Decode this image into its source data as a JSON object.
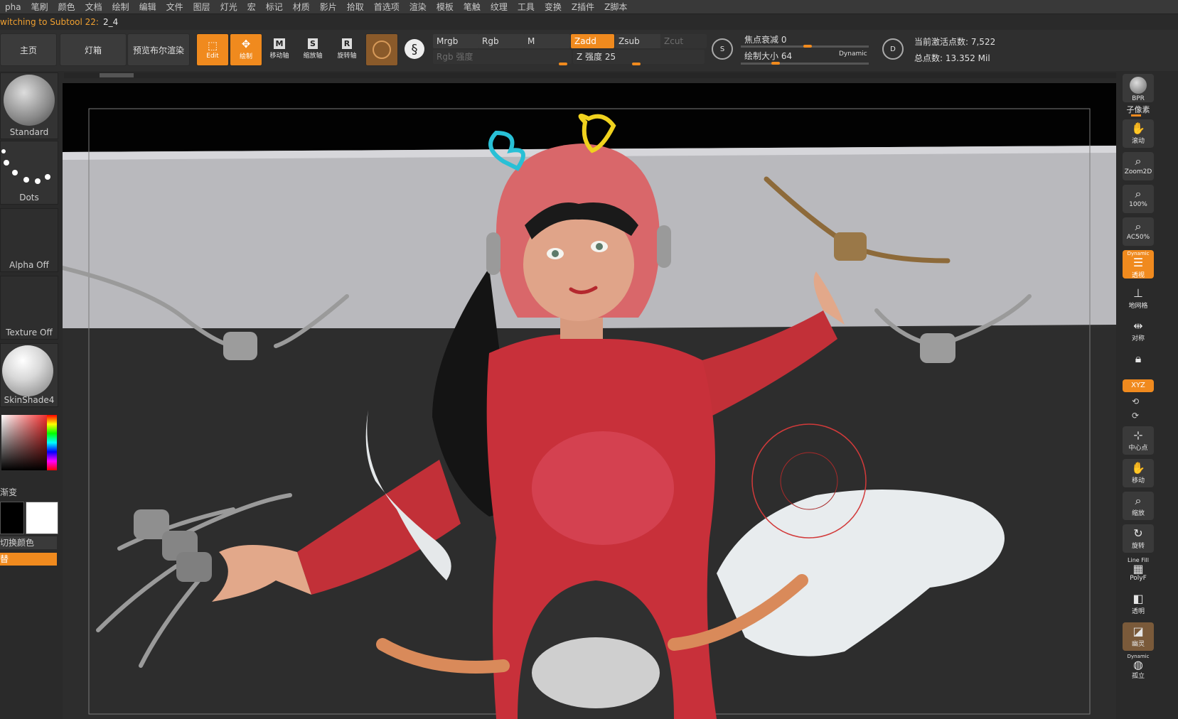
{
  "menu": [
    "pha",
    "笔刷",
    "颜色",
    "文档",
    "绘制",
    "编辑",
    "文件",
    "图层",
    "灯光",
    "宏",
    "标记",
    "材质",
    "影片",
    "拾取",
    "首选项",
    "渲染",
    "模板",
    "笔触",
    "纹理",
    "工具",
    "变换",
    "Z插件",
    "Z脚本"
  ],
  "status": {
    "prefix": "witching to Subtool 22:",
    "value": "2_4"
  },
  "toolbar": {
    "home": "主页",
    "lightbox": "灯箱",
    "bpr_preview": "预览布尔渲染",
    "edit": "Edit",
    "draw": "绘制",
    "move": "移动轴",
    "scale": "缩放轴",
    "rotate": "旋转轴",
    "move_key": "M",
    "scale_key": "S",
    "rotate_key": "R",
    "mrgb": "Mrgb",
    "rgb": "Rgb",
    "m": "M",
    "rgb_intensity": "Rgb 强度",
    "zadd": "Zadd",
    "zsub": "Zsub",
    "zcut": "Zcut",
    "z_intensity": "Z 强度 25",
    "focal_shift": "焦点衰减 0",
    "draw_size": "绘制大小 64",
    "dynamic": "Dynamic",
    "s_label": "S",
    "d_label": "D",
    "active_points": "当前激活点数: 7,522",
    "total_points": "总点数: 13.352 Mil"
  },
  "left": {
    "brush": "Standard",
    "stroke": "Dots",
    "alpha": "Alpha Off",
    "texture": "Texture Off",
    "material": "SkinShade4",
    "gradient": "渐变",
    "swap_color": "切换颜色",
    "replace": "替"
  },
  "right": {
    "bpr": "BPR",
    "subpixel": "子像素",
    "scroll": "滚动",
    "zoom2d": "Zoom2D",
    "actual": "100%",
    "ac50": "AC50%",
    "dynamic": "Dynamic",
    "persp": "透视",
    "floor": "地网格",
    "sym": "对称",
    "lock": "",
    "xyz": "XYZ",
    "center": "中心点",
    "move": "移动",
    "scale": "缩放",
    "rotate": "旋转",
    "linefill": "Line Fill",
    "polyf": "PolyF",
    "transp": "透明",
    "ghost": "幽灵",
    "dynamic2": "Dynamic",
    "solo": "孤立"
  },
  "colors": {
    "accent": "#f08a1e",
    "sweater": "#c8303a",
    "helmet": "#d9676a"
  }
}
